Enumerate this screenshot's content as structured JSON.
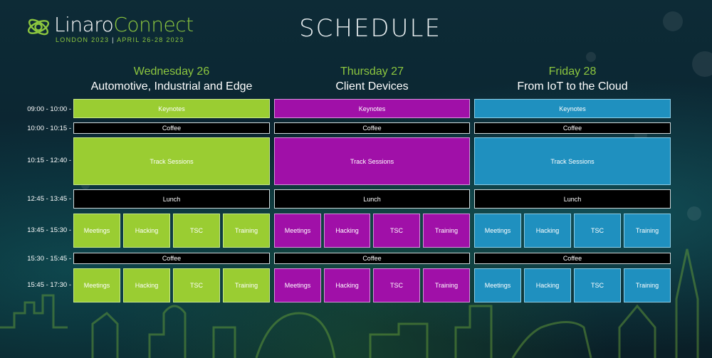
{
  "header": {
    "logo_word1": "Linaro",
    "logo_word2": "Connect",
    "logo_sub_city": "LONDON 2023",
    "logo_sub_sep": " | ",
    "logo_sub_dates": "APRIL 26-28 2023",
    "title": "SCHEDULE"
  },
  "colors": {
    "brand_green": "#8cc63f",
    "day1": "#9acd32",
    "day2": "#a010a8",
    "day3": "#1f90bf",
    "break": "#000000"
  },
  "times": [
    "09:00 - 10:00 -",
    "10:00 - 10:15 -",
    "10:15 - 12:40 -",
    "12:45 - 13:45 -",
    "13:45 - 15:30 -",
    "15:30 - 15:45 -",
    "15:45 - 17:30 -"
  ],
  "days": [
    {
      "name": "Wednesday 26",
      "theme": "Automotive, Industrial and Edge",
      "keynotes": "Keynotes",
      "coffee": "Coffee",
      "track": "Track Sessions",
      "lunch": "Lunch",
      "pm1": [
        "Meetings",
        "Hacking",
        "TSC",
        "Training"
      ],
      "coffee2": "Coffee",
      "pm2": [
        "Meetings",
        "Hacking",
        "TSC",
        "Training"
      ]
    },
    {
      "name": "Thursday 27",
      "theme": "Client Devices",
      "keynotes": "Keynotes",
      "coffee": "Coffee",
      "track": "Track Sessions",
      "lunch": "Lunch",
      "pm1": [
        "Meetings",
        "Hacking",
        "TSC",
        "Training"
      ],
      "coffee2": "Coffee",
      "pm2": [
        "Meetings",
        "Hacking",
        "TSC",
        "Training"
      ]
    },
    {
      "name": "Friday 28",
      "theme": "From IoT to the Cloud",
      "keynotes": "Keynotes",
      "coffee": "Coffee",
      "track": "Track Sessions",
      "lunch": "Lunch",
      "pm1": [
        "Meetings",
        "Hacking",
        "TSC",
        "Training"
      ],
      "coffee2": "Coffee",
      "pm2": [
        "Meetings",
        "Hacking",
        "TSC",
        "Training"
      ]
    }
  ]
}
